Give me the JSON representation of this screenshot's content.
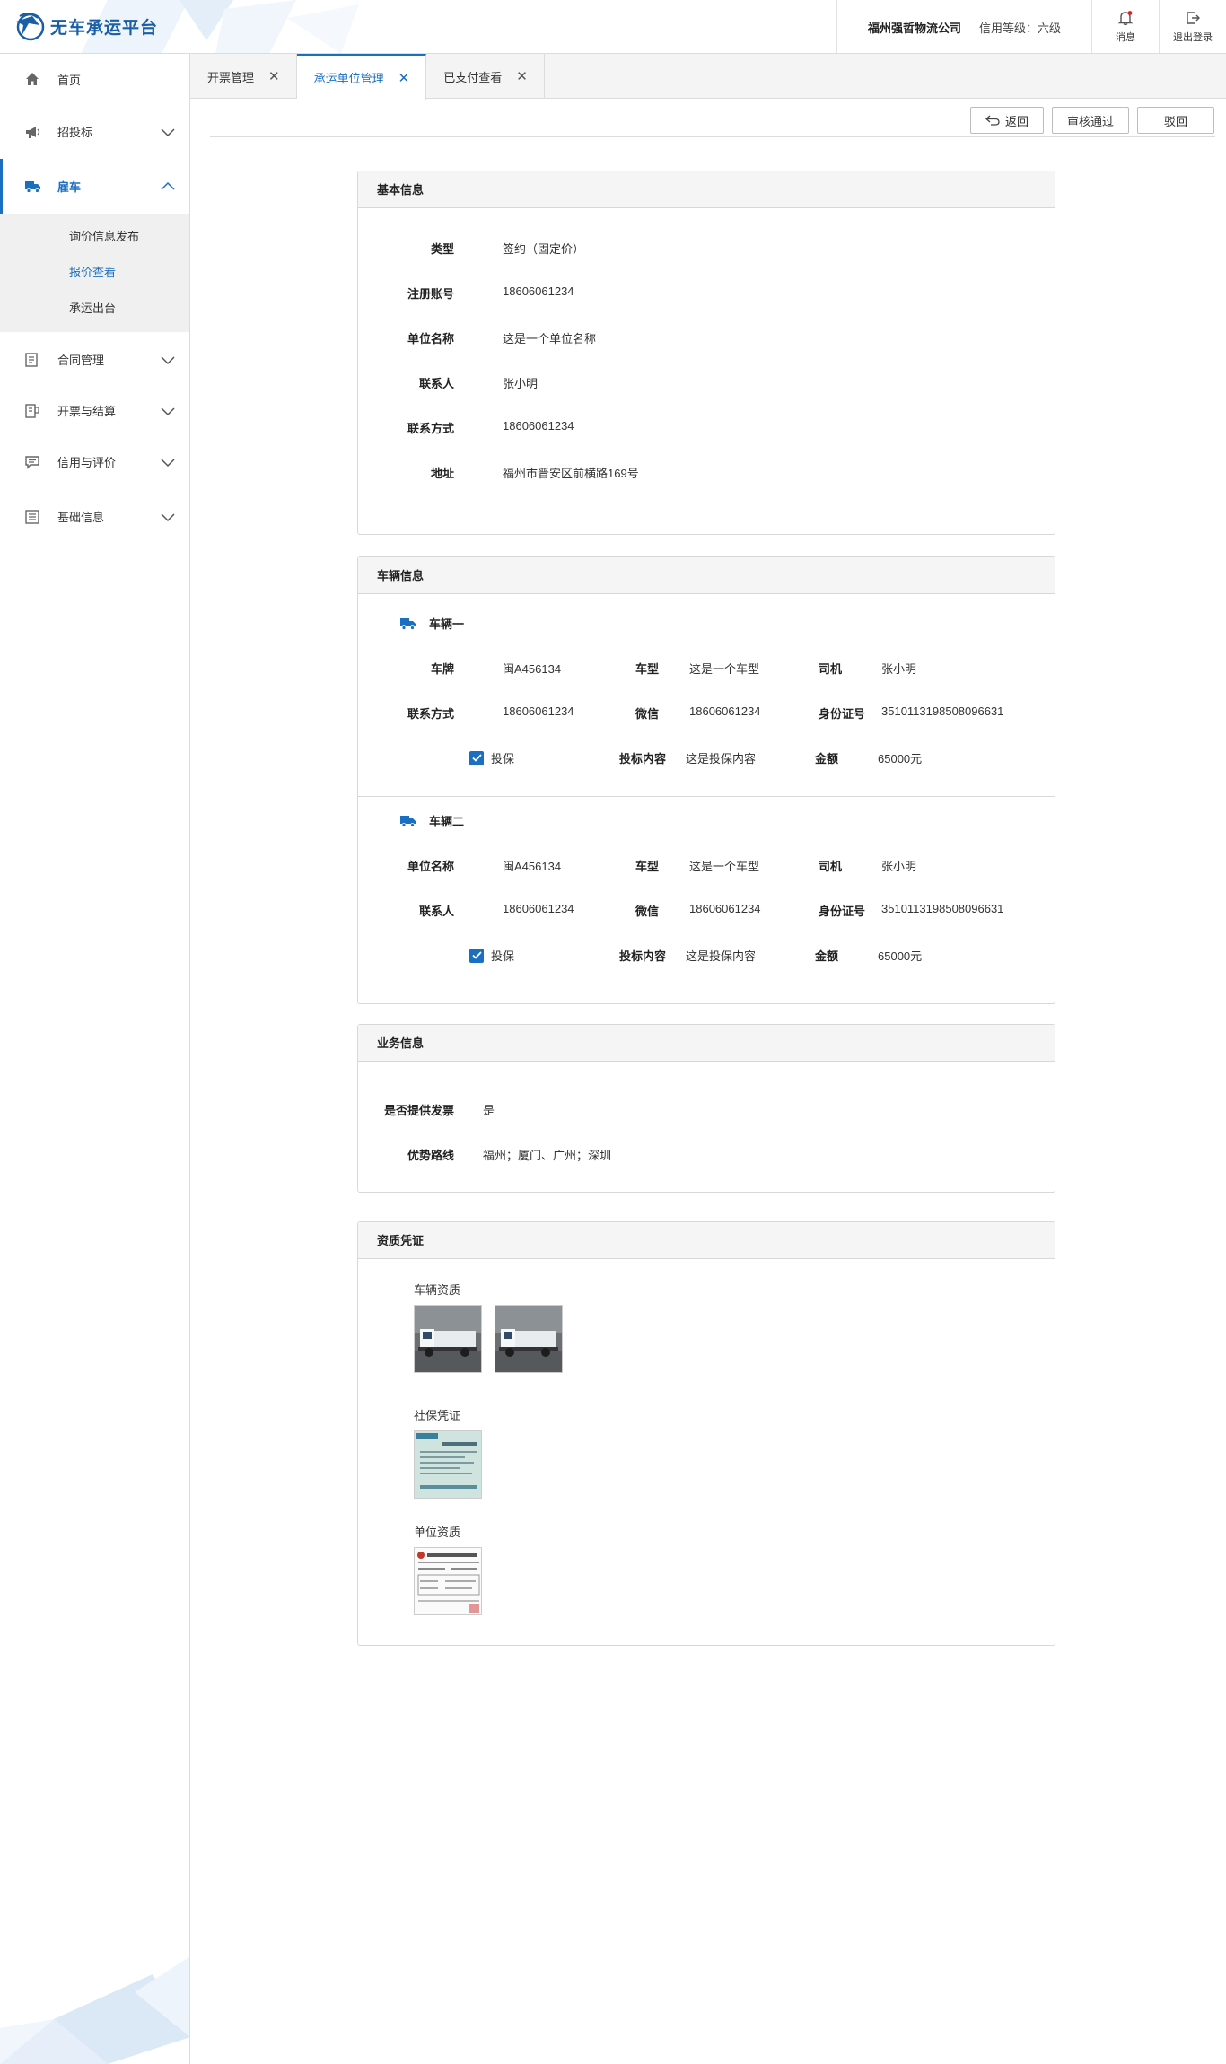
{
  "header": {
    "app_title": "无车承运平台",
    "company": "福州强哲物流公司",
    "credit_level": "信用等级：六级",
    "message_label": "消息",
    "logout_label": "退出登录",
    "brand_color": "#1a6fc0"
  },
  "sidebar": {
    "items": [
      {
        "label": "首页",
        "icon": "home-icon"
      },
      {
        "label": "招投标",
        "icon": "megaphone-icon"
      },
      {
        "label": "雇车",
        "icon": "truck-icon"
      },
      {
        "label": "合同管理",
        "icon": "contract-icon"
      },
      {
        "label": "开票与结算",
        "icon": "invoice-icon"
      },
      {
        "label": "信用与评价",
        "icon": "comment-icon"
      },
      {
        "label": "基础信息",
        "icon": "list-icon"
      }
    ],
    "sub_items": [
      "询价信息发布",
      "报价查看",
      "承运出台"
    ]
  },
  "tabs": [
    {
      "label": "开票管理"
    },
    {
      "label": "承运单位管理"
    },
    {
      "label": "已支付查看"
    }
  ],
  "toolbar": {
    "back_label": "返回",
    "approve_label": "审核通过",
    "reject_label": "驳回"
  },
  "basic": {
    "title": "基本信息",
    "rows": [
      {
        "label": "类型",
        "value": "签约（固定价）"
      },
      {
        "label": "注册账号",
        "value": "18606061234"
      },
      {
        "label": "单位名称",
        "value": "这是一个单位名称"
      },
      {
        "label": "联系人",
        "value": "张小明"
      },
      {
        "label": "联系方式",
        "value": "18606061234"
      },
      {
        "label": "地址",
        "value": "福州市晋安区前横路169号"
      }
    ]
  },
  "vehicles": {
    "title": "车辆信息",
    "list": [
      {
        "name": "车辆一",
        "row1": [
          [
            "车牌",
            "闽A456134"
          ],
          [
            "车型",
            "这是一个车型"
          ],
          [
            "司机",
            "张小明"
          ]
        ],
        "row2": [
          [
            "联系方式",
            "18606061234"
          ],
          [
            "微信",
            "18606061234"
          ],
          [
            "身份证号",
            "3510113198508096631"
          ]
        ],
        "insure_label": "投保",
        "insure_checked": true,
        "row3": [
          [
            "投标内容",
            "这是投保内容"
          ],
          [
            "金额",
            "65000元"
          ]
        ]
      },
      {
        "name": "车辆二",
        "row1": [
          [
            "单位名称",
            "闽A456134"
          ],
          [
            "车型",
            "这是一个车型"
          ],
          [
            "司机",
            "张小明"
          ]
        ],
        "row2": [
          [
            "联系人",
            "18606061234"
          ],
          [
            "微信",
            "18606061234"
          ],
          [
            "身份证号",
            "3510113198508096631"
          ]
        ],
        "insure_label": "投保",
        "insure_checked": true,
        "row3": [
          [
            "投标内容",
            "这是投保内容"
          ],
          [
            "金额",
            "65000元"
          ]
        ]
      }
    ]
  },
  "business": {
    "title": "业务信息",
    "rows": [
      {
        "label": "是否提供发票",
        "value": "是"
      },
      {
        "label": "优势路线",
        "value": "福州；厦门、广州；深圳"
      }
    ]
  },
  "qualification": {
    "title": "资质凭证",
    "groups": [
      {
        "label": "车辆资质"
      },
      {
        "label": "社保凭证"
      },
      {
        "label": "单位资质"
      }
    ]
  }
}
